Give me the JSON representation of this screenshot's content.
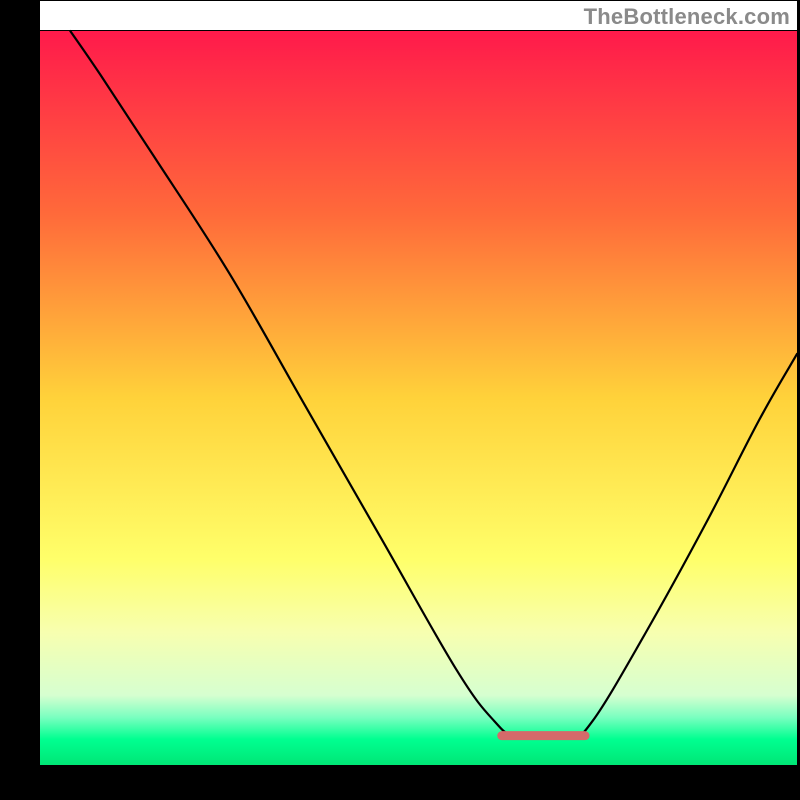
{
  "watermark": "TheBottleneck.com",
  "chart_data": {
    "type": "line",
    "title": "",
    "xlabel": "",
    "ylabel": "",
    "xlim": [
      0,
      100
    ],
    "ylim": [
      0,
      100
    ],
    "axes_visible": false,
    "grid": false,
    "background_gradient": {
      "stops": [
        {
          "offset": 0.0,
          "color": "#ff1a4b"
        },
        {
          "offset": 0.25,
          "color": "#ff6a3a"
        },
        {
          "offset": 0.5,
          "color": "#ffd23a"
        },
        {
          "offset": 0.72,
          "color": "#ffff6a"
        },
        {
          "offset": 0.82,
          "color": "#f7ffb0"
        },
        {
          "offset": 0.905,
          "color": "#d6ffd0"
        },
        {
          "offset": 0.935,
          "color": "#7affc0"
        },
        {
          "offset": 0.965,
          "color": "#00ff90"
        },
        {
          "offset": 1.0,
          "color": "#00e676"
        }
      ]
    },
    "frame": {
      "color": "#000000",
      "width_left": 40,
      "width_right": 3,
      "width_top": 1,
      "width_bottom": 35
    },
    "series": [
      {
        "name": "bottleneck-curve",
        "stroke": "#000000",
        "stroke_width": 2.2,
        "points": [
          {
            "x": 4,
            "y": 100
          },
          {
            "x": 8,
            "y": 94
          },
          {
            "x": 15,
            "y": 83
          },
          {
            "x": 25,
            "y": 67
          },
          {
            "x": 35,
            "y": 49
          },
          {
            "x": 45,
            "y": 31
          },
          {
            "x": 55,
            "y": 13
          },
          {
            "x": 60,
            "y": 6
          },
          {
            "x": 63,
            "y": 4
          },
          {
            "x": 70,
            "y": 4
          },
          {
            "x": 73,
            "y": 6
          },
          {
            "x": 80,
            "y": 18
          },
          {
            "x": 88,
            "y": 33
          },
          {
            "x": 95,
            "y": 47
          },
          {
            "x": 100,
            "y": 56
          }
        ]
      },
      {
        "name": "optimal-band",
        "type": "marker",
        "stroke": "#d46a6a",
        "stroke_width": 9,
        "points": [
          {
            "x": 61,
            "y": 4
          },
          {
            "x": 72,
            "y": 4
          }
        ]
      }
    ]
  }
}
